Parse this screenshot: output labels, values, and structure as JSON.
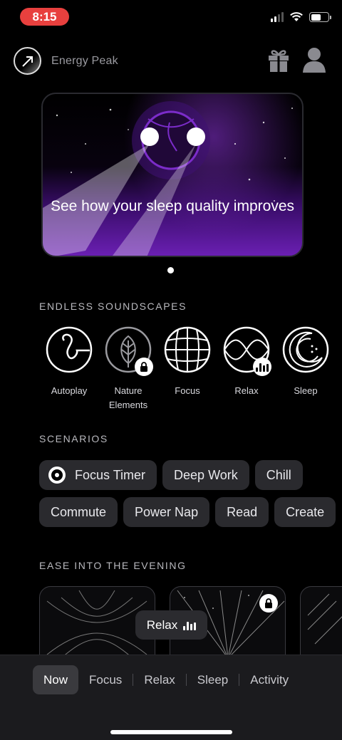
{
  "status_bar": {
    "time": "8:15"
  },
  "header": {
    "app_title": "Energy Peak"
  },
  "hero": {
    "text": "See how your sleep quality improves"
  },
  "sections": {
    "soundscapes_title": "ENDLESS SOUNDSCAPES",
    "scenarios_title": "SCENARIOS",
    "evening_title": "EASE INTO THE EVENING"
  },
  "soundscapes": [
    {
      "label": "Autoplay",
      "icon": "autoplay-icon",
      "badge": ""
    },
    {
      "label": "Nature Elements",
      "icon": "leaf-icon",
      "badge": "lock"
    },
    {
      "label": "Focus",
      "icon": "grid-sphere-icon",
      "badge": ""
    },
    {
      "label": "Relax",
      "icon": "wave-icon",
      "badge": "equalizer"
    },
    {
      "label": "Sleep",
      "icon": "moon-icon",
      "badge": ""
    }
  ],
  "scenarios": {
    "row1": [
      "Focus Timer",
      "Deep Work",
      "Chill"
    ],
    "row2": [
      "Commute",
      "Power Nap",
      "Read",
      "Create"
    ]
  },
  "mini_player": {
    "label": "Relax"
  },
  "tabs": [
    "Now",
    "Focus",
    "Relax",
    "Sleep",
    "Activity"
  ],
  "active_tab": "Now",
  "colors": {
    "accent": "#7b2cc9",
    "status_pill": "#e8403e",
    "chip_bg": "#2a2a2e",
    "tabbar_bg": "#1b1b1e"
  }
}
